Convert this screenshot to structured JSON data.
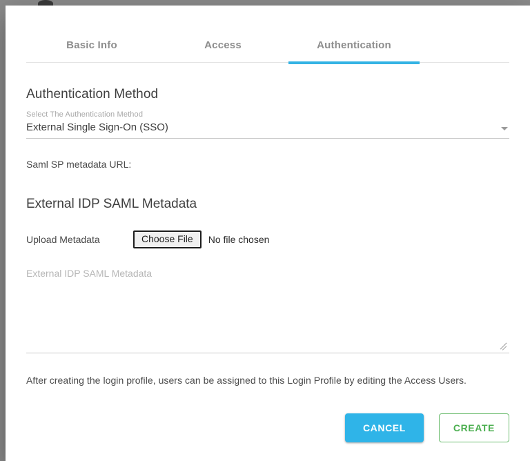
{
  "theme": {
    "accent_blue": "#2fb4e8",
    "tab_indicator": "#34b3e4",
    "create_green": "#4caf50",
    "backdrop": "#8c8c8c",
    "text_primary": "#3f3f3f",
    "text_muted": "#a8a8a8"
  },
  "tabs": [
    {
      "label": "Basic Info",
      "active": false
    },
    {
      "label": "Access",
      "active": false
    },
    {
      "label": "Authentication",
      "active": true
    }
  ],
  "auth_method": {
    "heading": "Authentication Method",
    "hint": "Select The Authentication Method",
    "selected_value": "External Single Sign-On (SSO)",
    "caret_icon": "chevron-down-icon",
    "options": [
      "External Single Sign-On (SSO)"
    ]
  },
  "saml_sp": {
    "label": "Saml SP metadata URL:",
    "value": ""
  },
  "external_idp": {
    "heading": "External IDP SAML Metadata",
    "upload_label": "Upload Metadata",
    "choose_file_label": "Choose File",
    "no_file_text": "No file chosen",
    "textarea_placeholder": "External IDP SAML Metadata",
    "textarea_value": ""
  },
  "footer": {
    "note": "After creating the login profile, users can be assigned to this Login Profile by editing the Access Users.",
    "cancel_label": "CANCEL",
    "create_label": "CREATE"
  }
}
